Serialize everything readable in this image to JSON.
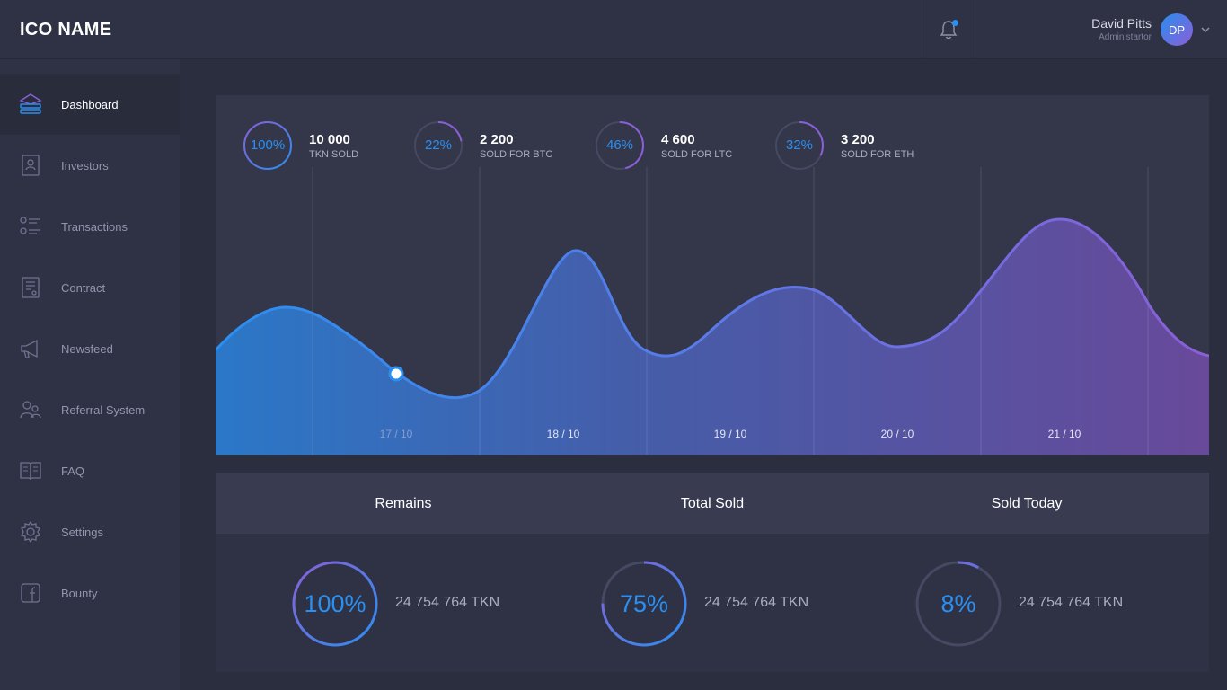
{
  "header": {
    "brand": "ICO NAME",
    "user_name": "David Pitts",
    "user_role": "Administartor",
    "avatar_initials": "DP"
  },
  "sidebar": {
    "items": [
      {
        "label": "Dashboard",
        "icon": "database-stack-icon",
        "active": true
      },
      {
        "label": "Investors",
        "icon": "id-card-icon"
      },
      {
        "label": "Transactions",
        "icon": "list-icon"
      },
      {
        "label": "Contract",
        "icon": "document-icon"
      },
      {
        "label": "Newsfeed",
        "icon": "megaphone-icon"
      },
      {
        "label": "Referral System",
        "icon": "users-icon"
      },
      {
        "label": "FAQ",
        "icon": "open-book-icon"
      },
      {
        "label": "Settings",
        "icon": "gear-icon"
      },
      {
        "label": "Bounty",
        "icon": "facebook-icon"
      }
    ]
  },
  "stats": [
    {
      "pct_label": "100%",
      "value": "10 000",
      "label": "TKN SOLD",
      "fraction": 1.0
    },
    {
      "pct_label": "22%",
      "value": "2 200",
      "label": "SOLD FOR BTC",
      "fraction": 0.22
    },
    {
      "pct_label": "46%",
      "value": "4 600",
      "label": "SOLD FOR LTC",
      "fraction": 0.46
    },
    {
      "pct_label": "32%",
      "value": "3 200",
      "label": "SOLD FOR ETH",
      "fraction": 0.32
    }
  ],
  "chart_data": {
    "type": "area",
    "x_labels": [
      "17 / 10",
      "18 / 10",
      "19 / 10",
      "20 / 10",
      "21 / 10"
    ],
    "grid": "vertical"
  },
  "summary": [
    {
      "title": "Remains",
      "pct_label": "100%",
      "fraction": 1.0,
      "amount": "24 754 764 TKN"
    },
    {
      "title": "Total Sold",
      "pct_label": "75%",
      "fraction": 0.75,
      "amount": "24 754 764 TKN"
    },
    {
      "title": "Sold Today",
      "pct_label": "8%",
      "fraction": 0.08,
      "amount": "24 754 764 TKN"
    }
  ],
  "colors": {
    "accent_blue": "#2b8ff0",
    "accent_purple": "#8a5fd8",
    "panel": "#343749",
    "sidebar": "#2f3245"
  }
}
